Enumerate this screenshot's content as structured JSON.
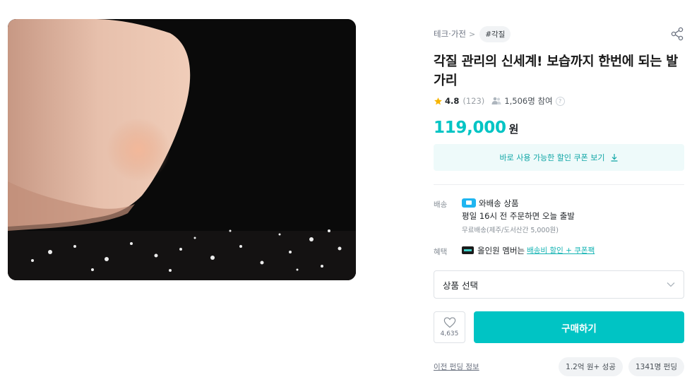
{
  "product_image": {
    "alt": "발 뒤꿈치 각질 관리 이미지"
  },
  "breadcrumb": {
    "category": "테크·가전",
    "separator": ">",
    "tag": "#각질"
  },
  "product": {
    "title": "각질 관리의 신세계! 보습까지 한번에 되는 발가리",
    "rating": "4.8",
    "review_count": "(123)",
    "participants": "1,506명 참여",
    "price": "119,000",
    "currency": "원"
  },
  "coupon": {
    "label": "바로 사용 가능한 할인 쿠폰 보기"
  },
  "shipping": {
    "label": "배송",
    "badge": "와배송 상품",
    "detail": "평일 16시 전 주문하면 오늘 출발",
    "note": "무료배송(제주/도서산간 5,000원)"
  },
  "benefit": {
    "label": "혜택",
    "text": "올인원 멤버는",
    "link": "배송비 할인 + 쿠폰팩"
  },
  "option_select": {
    "placeholder": "상품 선택"
  },
  "actions": {
    "like_count": "4,635",
    "buy_label": "구매하기"
  },
  "footer": {
    "prev_funding_link": "이전 펀딩 정보",
    "chips": [
      "1.2억 원+ 성공",
      "1341명 펀딩"
    ]
  },
  "colors": {
    "accent": "#00c4c4",
    "coupon_bg": "#eefafa",
    "star": "#f7b500"
  }
}
